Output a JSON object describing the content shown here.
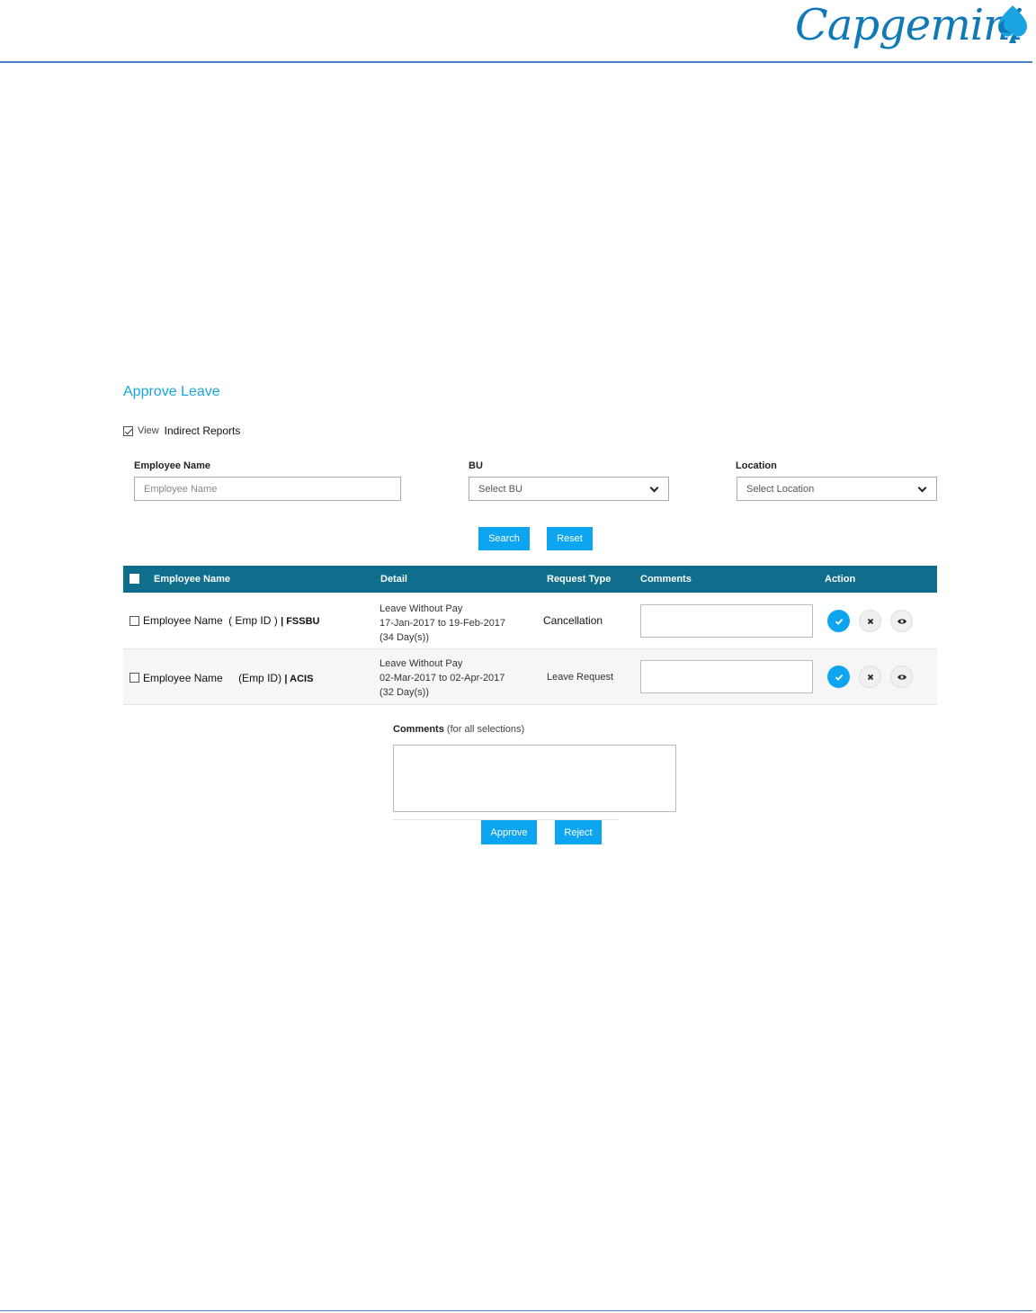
{
  "brand": {
    "logo_text": "Capgemini",
    "accent_color": "#1279b8",
    "rule_color": "#4a7ec8"
  },
  "page": {
    "title": "Approve Leave",
    "title_color": "#1ba5e0"
  },
  "view_toggle": {
    "checked": true,
    "label_view": "View",
    "label_reports": "Indirect Reports"
  },
  "filters": {
    "employee_name": {
      "label": "Employee Name",
      "placeholder": "Employee Name"
    },
    "bu": {
      "label": "BU",
      "selected": "Select BU"
    },
    "location": {
      "label": "Location",
      "selected": "Select Location"
    }
  },
  "filter_actions": {
    "search_label": "Search",
    "reset_label": "Reset",
    "button_color": "#0ea5f0"
  },
  "table": {
    "header_color": "#0e6e8c",
    "columns": [
      "Employee Name",
      "Detail",
      "Request Type",
      "Comments",
      "Action"
    ],
    "rows": [
      {
        "name": "Employee Name",
        "emp_id": "( Emp ID    )",
        "bu": "| FSSBU",
        "leave_type": "Leave Without Pay",
        "dates": "17-Jan-2017 to 19-Feb-2017",
        "days": "(34 Day(s))",
        "request_type": "Cancellation",
        "comment": ""
      },
      {
        "name": "Employee Name",
        "emp_id": "(Emp ID)",
        "bu": "| ACIS",
        "leave_type": "Leave Without Pay",
        "dates": "02-Mar-2017 to 02-Apr-2017",
        "days": "(32 Day(s))",
        "request_type": "Leave Request",
        "comment": ""
      }
    ],
    "action_icons": [
      "check-icon",
      "close-icon",
      "eye-icon"
    ]
  },
  "bulk": {
    "comments_label": "Comments",
    "comments_sub": "(for all selections)",
    "comment_value": "",
    "approve_label": "Approve",
    "reject_label": "Reject"
  }
}
